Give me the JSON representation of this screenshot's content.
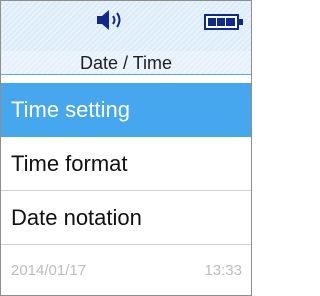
{
  "status_bar": {
    "speaker_icon": "speaker-volume-icon",
    "battery_icon": "battery-full-icon"
  },
  "screen": {
    "title": "Date / Time"
  },
  "menu": {
    "items": [
      {
        "label": "Time setting",
        "selected": true
      },
      {
        "label": "Time format",
        "selected": false
      },
      {
        "label": "Date notation",
        "selected": false
      }
    ]
  },
  "footer": {
    "date": "2014/01/17",
    "time": "13:33"
  },
  "colors": {
    "accent": "#47a7ee",
    "status_bar_bg": "#ddecf9",
    "icon": "#0d2a8c",
    "footer_text": "#bdbdbd"
  }
}
